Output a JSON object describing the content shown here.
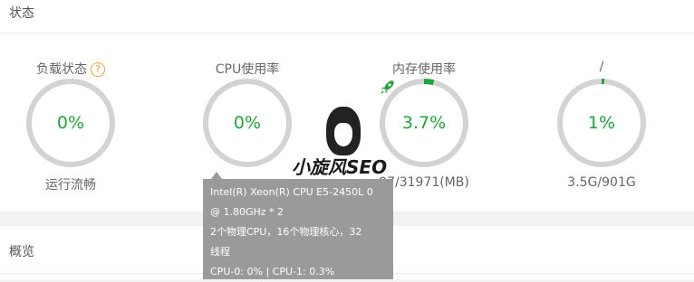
{
  "status_panel": {
    "title": "状态"
  },
  "gauges": [
    {
      "label": "负载状态",
      "value": "0%",
      "sub": "运行流畅",
      "help_icon": "?",
      "fraction": 0.0
    },
    {
      "label": "CPU使用率",
      "value": "0%",
      "sub": "",
      "fraction": 0.0
    },
    {
      "label": "内存使用率",
      "value": "3.7%",
      "sub": "97/31971(MB)",
      "icon": "rocket-icon",
      "fraction": 0.037
    },
    {
      "label": "/",
      "value": "1%",
      "sub": "3.5G/901G",
      "fraction": 0.01
    }
  ],
  "watermark": {
    "brand": "小旋风SEO"
  },
  "overview_panel": {
    "title": "概览"
  },
  "tooltip": {
    "lines": [
      "Intel(R) Xeon(R) CPU E5-2450L 0",
      "@ 1.80GHz * 2",
      "2个物理CPU，16个物理核心，32",
      "线程",
      "CPU-0: 0% | CPU-1: 0.3%"
    ]
  },
  "colors": {
    "accent": "#20a53a",
    "ring_bg": "#d3d3d3",
    "help": "#e8a33a",
    "tooltip_bg": "#9a9a9a"
  }
}
